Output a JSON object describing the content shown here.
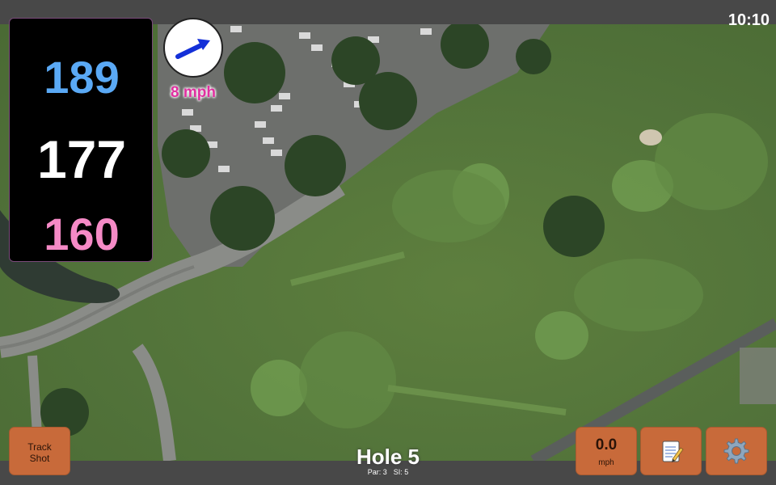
{
  "status_bar": {
    "time": "10:10"
  },
  "distances": {
    "back": "189",
    "center": "177",
    "front": "160"
  },
  "wind": {
    "speed_label": "8 mph",
    "direction_icon": "wind-arrow-icon",
    "meter_value": "0.0",
    "meter_unit": "mph"
  },
  "buttons": {
    "track_shot_line1": "Track",
    "track_shot_line2": "Shot",
    "notes_icon": "notepad-icon",
    "settings_icon": "gear-icon"
  },
  "hole": {
    "title": "Hole 5",
    "par": "Par: 3",
    "si": "SI: 5"
  },
  "colors": {
    "back": "#5aa9f5",
    "center": "#ffffff",
    "front": "#f58ac6",
    "button": "#c86a3a",
    "wind_text": "#e030a0"
  }
}
